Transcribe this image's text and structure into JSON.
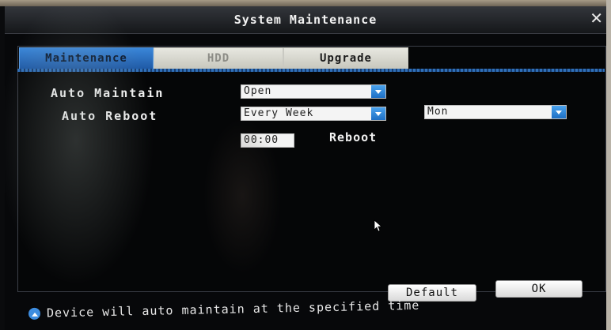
{
  "window": {
    "title": "System Maintenance",
    "close_glyph": "✕"
  },
  "tabs": [
    {
      "label": "Maintenance",
      "active": true
    },
    {
      "label": "HDD",
      "active": false
    },
    {
      "label": "Upgrade",
      "active": false
    }
  ],
  "form": {
    "auto_maintain": {
      "label": "Auto Maintain",
      "value": "Open"
    },
    "auto_reboot": {
      "label": "Auto Reboot",
      "frequency": "Every Week",
      "day": "Mon",
      "time": "00:00",
      "reboot_label": "Reboot"
    }
  },
  "buttons": {
    "default_label": "Default",
    "ok_label": "OK"
  },
  "status": {
    "icon": "info-icon",
    "text": "Device will auto maintain at the specified time"
  },
  "colors": {
    "accent": "#2a74c8",
    "background": "#07080a",
    "text": "#f3f3f3"
  }
}
